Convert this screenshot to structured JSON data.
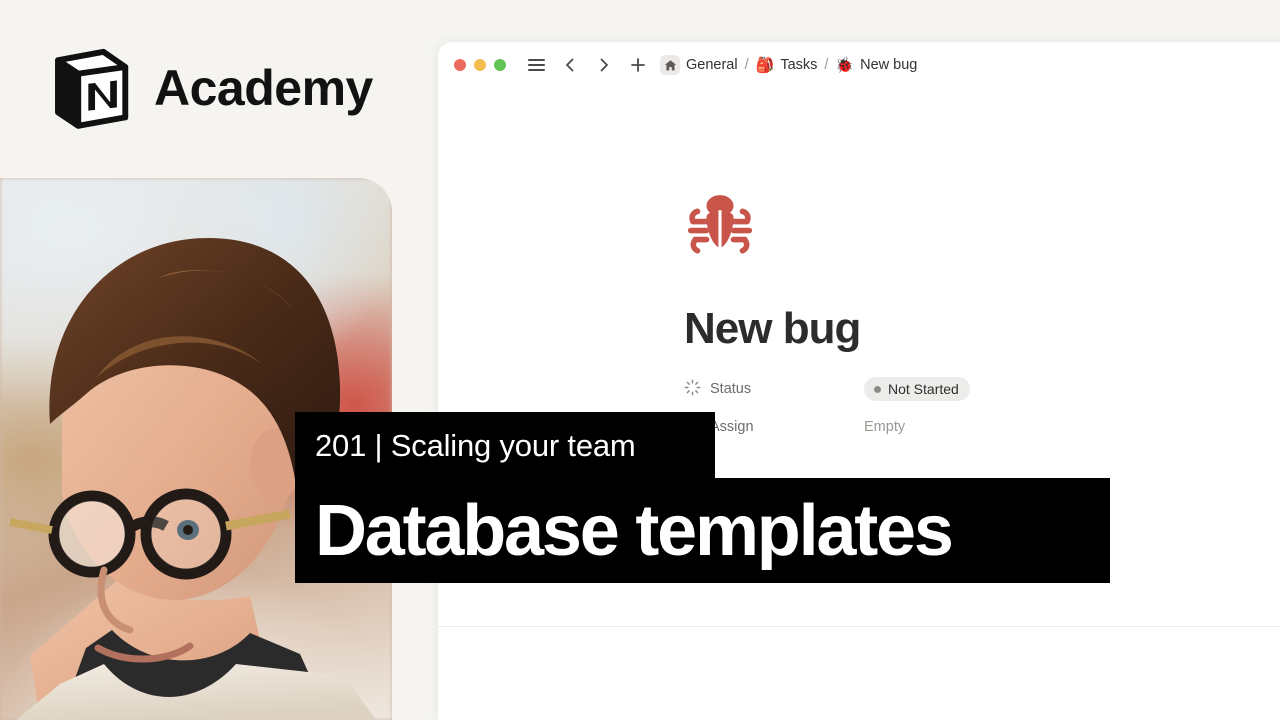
{
  "brand": {
    "logo_icon": "notion-cube-icon",
    "name": "Academy"
  },
  "photo": {
    "alt": "person with round glasses and short brown hair in an office"
  },
  "browser": {
    "traffic_lights": [
      {
        "name": "close-button",
        "color": "#ED6A5E"
      },
      {
        "name": "minimize-button",
        "color": "#F4BD4F"
      },
      {
        "name": "maximize-button",
        "color": "#61C454"
      }
    ],
    "nav": {
      "menu_icon": "hamburger-menu-icon",
      "back_icon": "chevron-left-icon",
      "forward_icon": "chevron-right-icon",
      "new_icon": "plus-icon"
    },
    "breadcrumb": {
      "separator": "/",
      "items": [
        {
          "icon": "home-icon",
          "label": "General"
        },
        {
          "icon": "backpack-emoji",
          "emoji": "🎒",
          "label": "Tasks"
        },
        {
          "icon": "bug-emoji",
          "emoji": "🐞",
          "label": "New bug"
        }
      ]
    }
  },
  "page": {
    "icon": "bug-icon",
    "icon_color": "#C9544A",
    "title": "New bug",
    "properties": [
      {
        "icon": "status-spinner-icon",
        "key": "Status",
        "value": "Not Started",
        "value_type": "select-pill",
        "pill_bg": "#ECECEB",
        "pill_dot": "#8D8B88"
      },
      {
        "icon": "person-icon",
        "key": "Assign",
        "value": "Empty",
        "value_type": "empty"
      }
    ]
  },
  "overlay": {
    "subtitle": "201 | Scaling your team",
    "title": "Database templates",
    "bg": "#000000",
    "fg": "#FFFFFF"
  },
  "colors": {
    "canvas": "#F5F4F1",
    "window": "#FFFFFF",
    "text": "#2E2C2A",
    "muted": "#706D69"
  }
}
